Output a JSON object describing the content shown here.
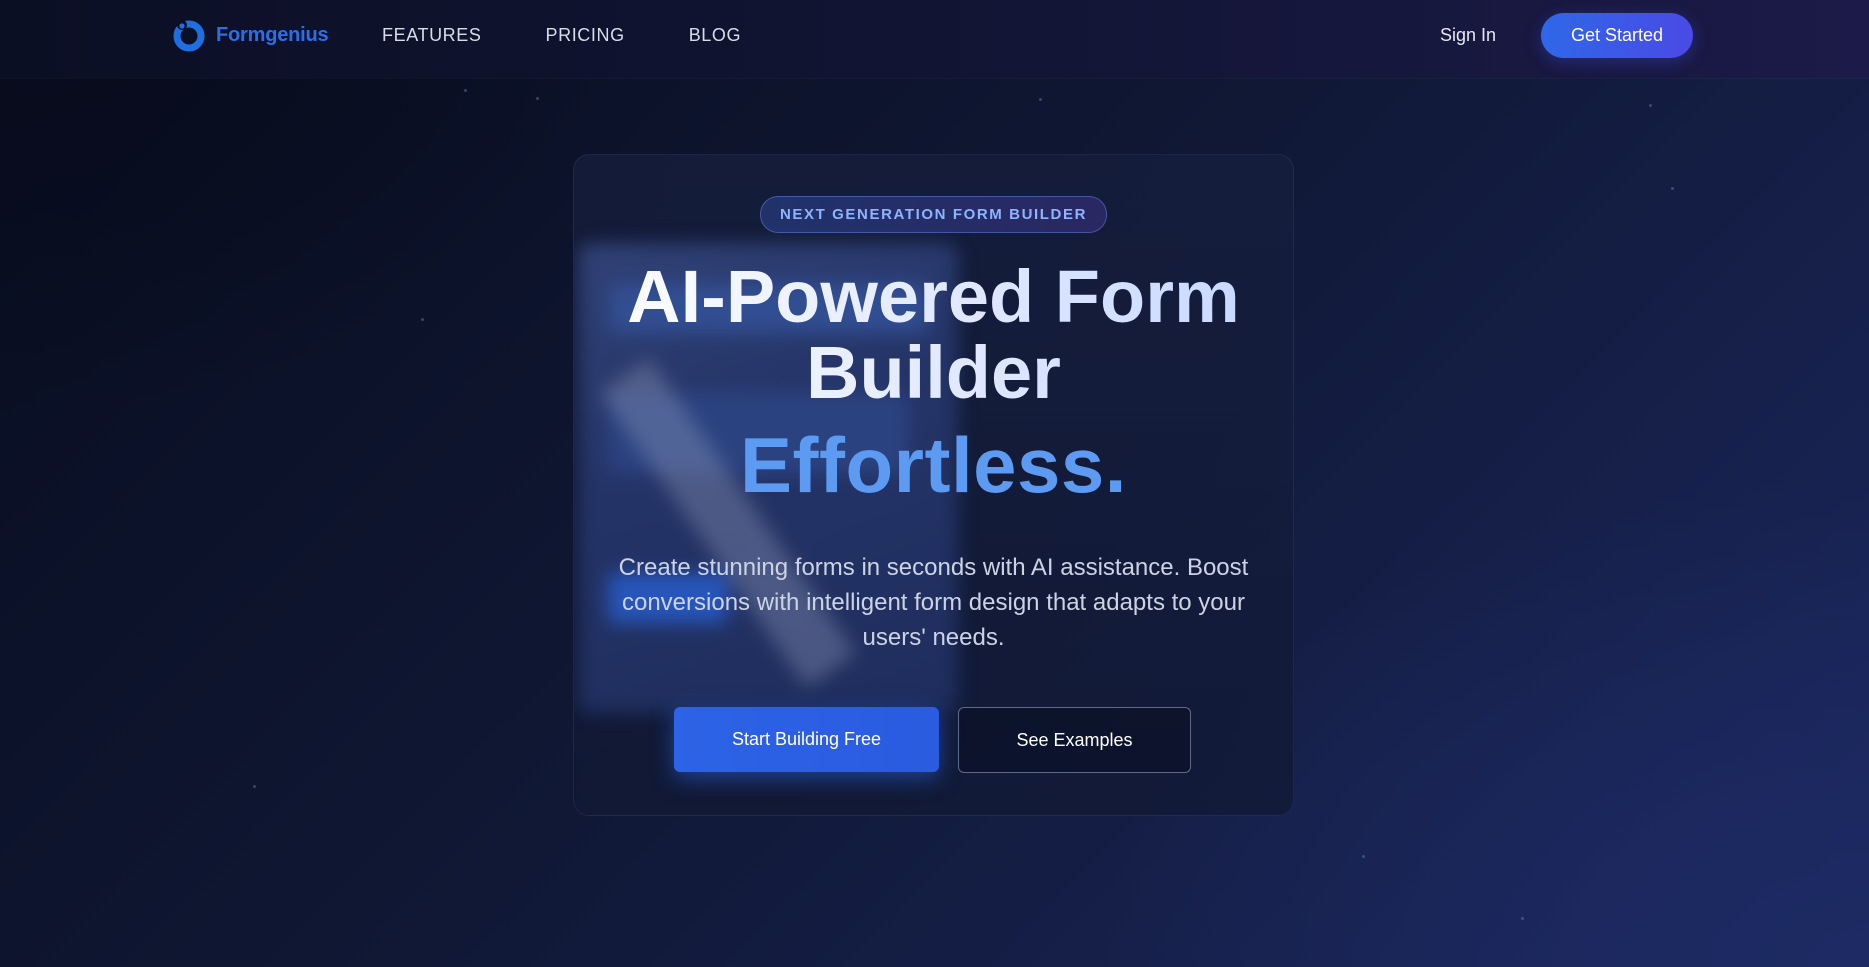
{
  "nav": {
    "brand_name": "Formgenius",
    "brand_icon": "formgenius-logo-icon",
    "links": [
      {
        "label": "FEATURES"
      },
      {
        "label": "PRICING"
      },
      {
        "label": "BLOG"
      }
    ],
    "sign_in": "Sign In",
    "get_started": "Get Started"
  },
  "hero": {
    "badge": "NEXT GENERATION FORM BUILDER",
    "headline": "AI-Powered Form Builder",
    "headline_accent": "Effortless.",
    "subtext": "Create stunning forms in seconds with AI assistance. Boost conversions with intelligent form design that adapts to your users' needs.",
    "primary_cta": "Start Building Free",
    "secondary_cta": "See Examples"
  },
  "colors": {
    "brand": "#2b6fe8",
    "accent": "#5d9af2",
    "primary_button": "#2d63e6",
    "background": "#0f1733"
  }
}
